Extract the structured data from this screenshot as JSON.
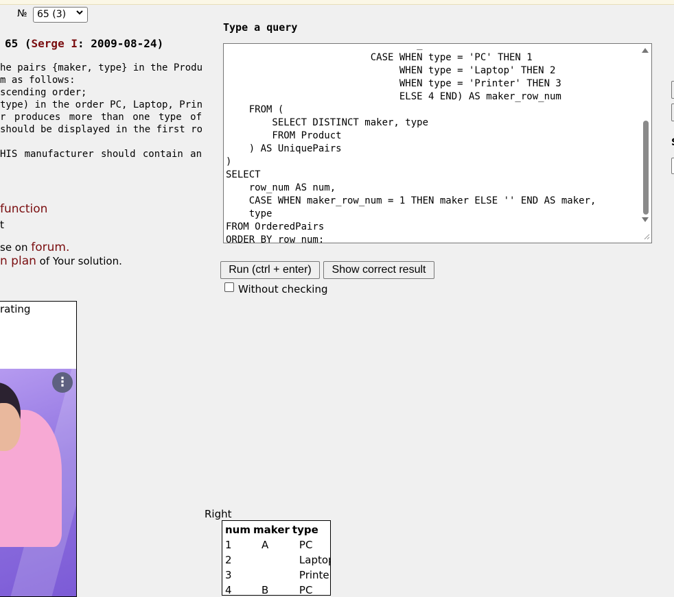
{
  "problem_selector": {
    "label": "№",
    "value": "65 (3)"
  },
  "problem": {
    "number": "65",
    "author": "Serge I",
    "date": "2009-08-24",
    "description_lines": [
      "he pairs {maker, type} in the Product",
      "m as follows:",
      "scending order;",
      "type) in the order PC, Laptop, Printer.",
      "r produces more than one type of",
      " should be displayed in the first row",
      "",
      "HIS manufacturer should contain an"
    ],
    "function_link": "function",
    "small_text": "t",
    "forum_prefix": "se on ",
    "forum_link": "forum.",
    "plan_link": "n plan",
    "plan_suffix": " of Your solution."
  },
  "rating": {
    "label": "rating"
  },
  "ad": {
    "menu_icon": "⋮"
  },
  "query": {
    "title": "Type a query",
    "text": "                                 _\n                         CASE WHEN type = 'PC' THEN 1\n                              WHEN type = 'Laptop' THEN 2\n                              WHEN type = 'Printer' THEN 3\n                              ELSE 4 END) AS maker_row_num\n    FROM (\n        SELECT DISTINCT maker, type\n        FROM Product\n    ) AS UniquePairs\n)\nSELECT\n    row_num AS num,\n    CASE WHEN maker_row_num = 1 THEN maker ELSE '' END AS maker,\n    type\nFROM OrderedPairs\nORDER BY row_num;"
  },
  "buttons": {
    "run": "Run (ctrl + enter)",
    "show": "Show correct result"
  },
  "without_checking": "Without checking",
  "edge_letter": "S",
  "result": {
    "label": "Right",
    "headers": [
      "num",
      "maker",
      "type"
    ],
    "rows": [
      [
        "1",
        "A",
        "PC"
      ],
      [
        "2",
        "",
        "Laptop"
      ],
      [
        "3",
        "",
        "Printer"
      ],
      [
        "4",
        "B",
        "PC"
      ]
    ]
  }
}
